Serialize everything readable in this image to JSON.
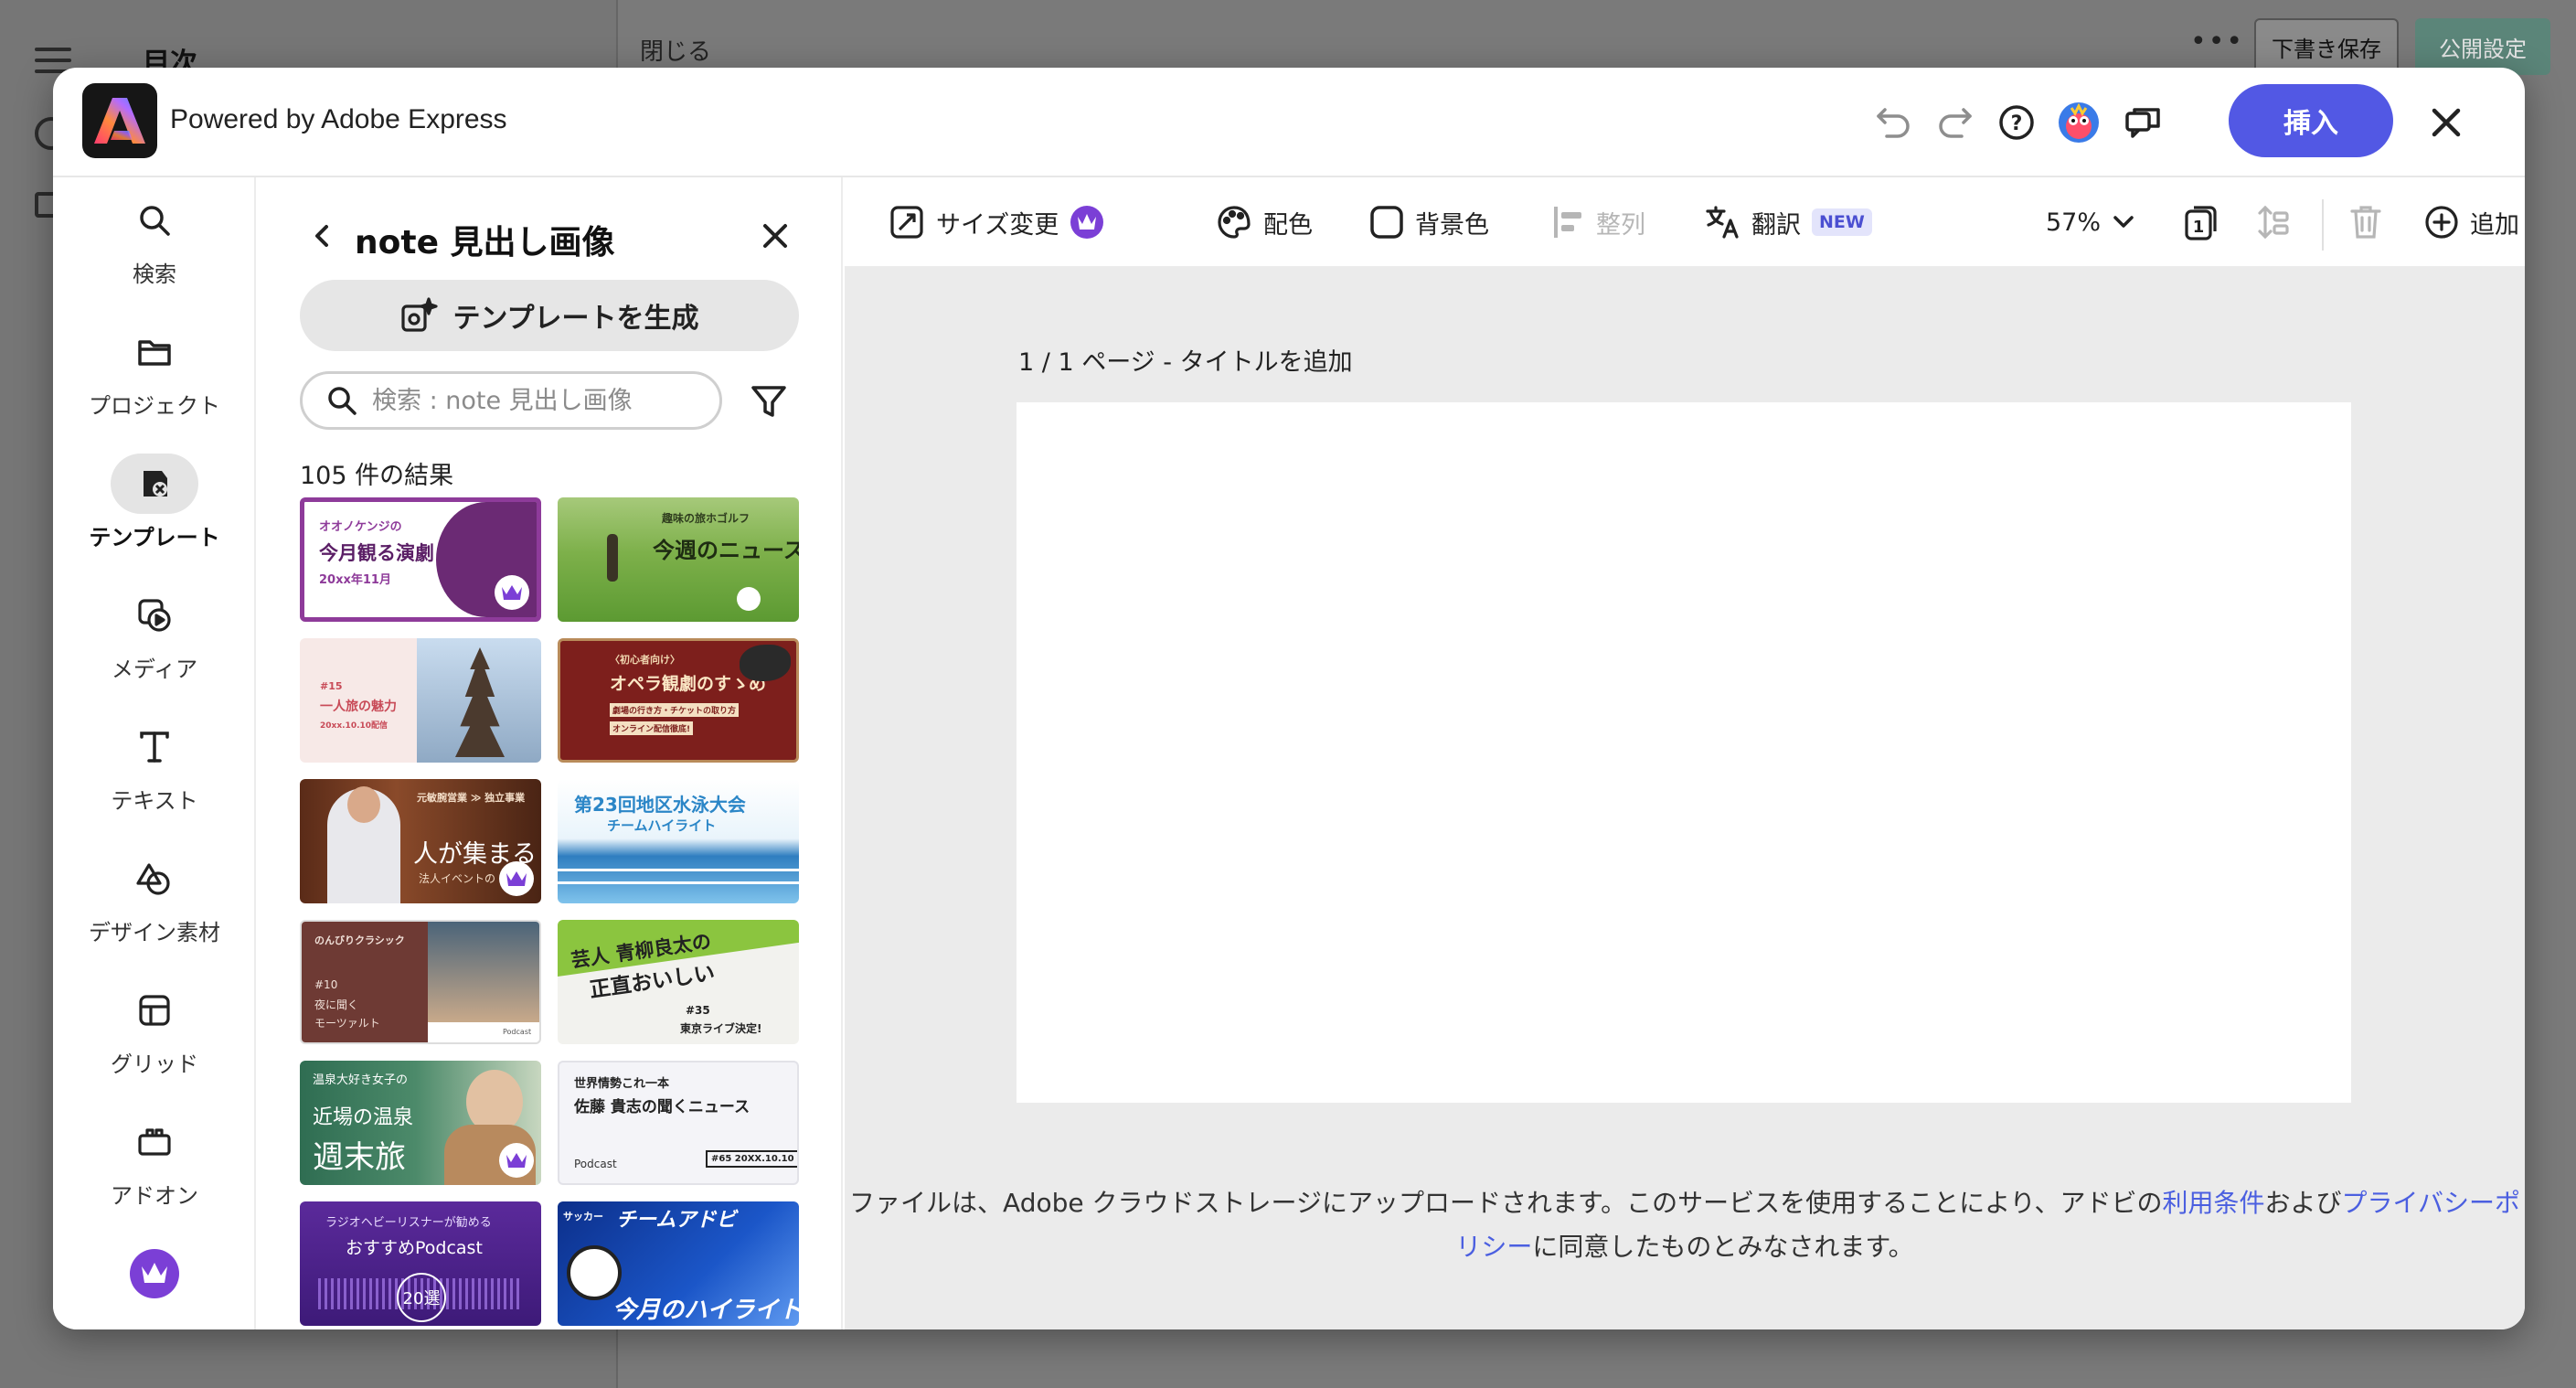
{
  "background": {
    "toc_label": "目次",
    "close_label": "閉じる",
    "draft_button": "下書き保存",
    "publish_button": "公開設定"
  },
  "header": {
    "title": "Powered by Adobe Express",
    "insert_label": "挿入",
    "accent": "#5258e4"
  },
  "rail": [
    {
      "label": "検索",
      "icon": "search-icon"
    },
    {
      "label": "プロジェクト",
      "icon": "folder-icon"
    },
    {
      "label": "テンプレート",
      "icon": "template-icon",
      "active": true
    },
    {
      "label": "メディア",
      "icon": "media-icon"
    },
    {
      "label": "テキスト",
      "icon": "text-icon"
    },
    {
      "label": "デザイン素材",
      "icon": "shapes-icon"
    },
    {
      "label": "グリッド",
      "icon": "grid-icon"
    },
    {
      "label": "アドオン",
      "icon": "addon-icon"
    },
    {
      "label": "",
      "icon": "premium-crown-icon"
    }
  ],
  "panel": {
    "title": "note 見出し画像",
    "generate_label": "テンプレートを生成",
    "search_placeholder": "検索 : note 見出し画像",
    "results": "105 件の結果"
  },
  "templates": [
    {
      "lines": [
        "オオノケンジの",
        "今月観る演劇",
        "20xx年11月"
      ],
      "premium": true
    },
    {
      "lines": [
        "趣味の旅ホゴルフ",
        "今週のニュース"
      ],
      "premium": false
    },
    {
      "lines": [
        "#15",
        "一人旅の魅力",
        "20xx.10.10配信"
      ],
      "premium": false
    },
    {
      "lines": [
        "〈初心者向け〉",
        "オペラ観劇のすゝめ",
        "劇場の行き方・チケットの取り方",
        "オンライン配信徹底!"
      ],
      "premium": false
    },
    {
      "lines": [
        "元敏腕営業 ≫ 独立事業",
        "人が集まる",
        "法人イベントの"
      ],
      "premium": true
    },
    {
      "lines": [
        "第23回地区水泳大会",
        "チームハイライト"
      ],
      "premium": false
    },
    {
      "lines": [
        "のんびりクラシック",
        "#10",
        "夜に聞く",
        "モーツァルト",
        "Podcast"
      ],
      "premium": false
    },
    {
      "lines": [
        "芸人 青柳良太の",
        "正直おいしい",
        "#35",
        "東京ライブ決定!"
      ],
      "premium": false
    },
    {
      "lines": [
        "温泉大好き女子の",
        "近場の温泉",
        "週末旅"
      ],
      "premium": true
    },
    {
      "lines": [
        "世界情勢これ一本",
        "佐藤 貴志の聞くニュース",
        "Podcast",
        "#65 20XX.10.10"
      ],
      "premium": false
    },
    {
      "lines": [
        "ラジオヘビーリスナーが勧める",
        "おすすめPodcast",
        "20選"
      ],
      "premium": false
    },
    {
      "lines": [
        "サッカー",
        "チームアドビ",
        "今月のハイライト"
      ],
      "premium": false
    }
  ],
  "toolbar": {
    "resize": "サイズ変更",
    "color": "配色",
    "background": "背景色",
    "align": "整列",
    "translate": "翻訳",
    "new_badge": "NEW",
    "zoom": "57%",
    "add": "追加"
  },
  "canvas": {
    "page_label": "1 / 1 ページ - タイトルを追加"
  },
  "footer": {
    "before": "ファイルは、Adobe クラウドストレージにアップロードされます。このサービスを使用することにより、アドビの",
    "terms": "利用条件",
    "middle": "および",
    "privacy": "プライバシーポリシー",
    "after": "に同意したものとみなされます。"
  }
}
